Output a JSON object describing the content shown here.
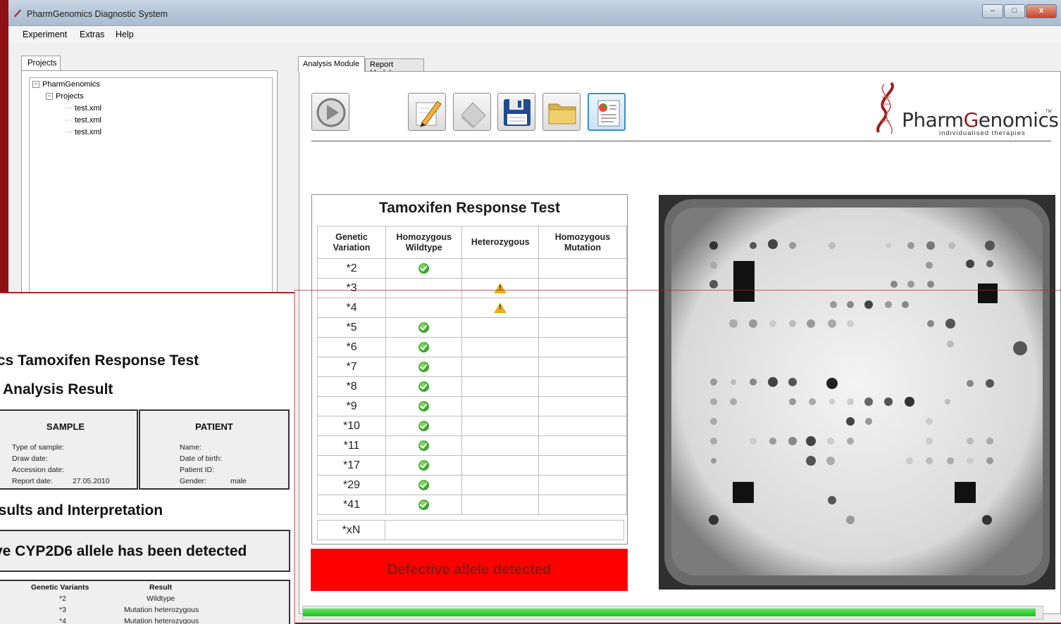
{
  "window": {
    "title": "PharmGenomics Diagnostic System"
  },
  "menu": [
    "Experiment",
    "Extras",
    "Help"
  ],
  "left_panel": {
    "tab_label": "Projects",
    "tree": {
      "root": "PharmGenomics",
      "folder": "Projects",
      "files": [
        "test.xml",
        "test.xml",
        "test.xml"
      ]
    }
  },
  "tabs": {
    "analysis": "Analysis Module",
    "report": "Report Module"
  },
  "toolbar": {
    "icons": [
      "play-icon",
      "edit-pencil-icon",
      "eraser-icon",
      "save-disk-icon",
      "open-folder-icon",
      "report-document-icon"
    ]
  },
  "logo": {
    "pre": "Pharm",
    "g": "G",
    "post": "enomics",
    "tm": "TM",
    "tagline": "individualised therapies"
  },
  "test": {
    "title": "Tamoxifen Response Test",
    "headers": {
      "genetic_variation": "Genetic Variation",
      "hom_wildtype": "Homozygous Wildtype",
      "heterozygous": "Heterozygous",
      "hom_mutation": "Homozygous Mutation"
    },
    "rows": [
      {
        "variant": "*2",
        "status": "wildtype"
      },
      {
        "variant": "*3",
        "status": "heterozygous"
      },
      {
        "variant": "*4",
        "status": "heterozygous"
      },
      {
        "variant": "*5",
        "status": "wildtype"
      },
      {
        "variant": "*6",
        "status": "wildtype"
      },
      {
        "variant": "*7",
        "status": "wildtype"
      },
      {
        "variant": "*8",
        "status": "wildtype"
      },
      {
        "variant": "*9",
        "status": "wildtype"
      },
      {
        "variant": "*10",
        "status": "wildtype"
      },
      {
        "variant": "*11",
        "status": "wildtype"
      },
      {
        "variant": "*17",
        "status": "wildtype"
      },
      {
        "variant": "*29",
        "status": "wildtype"
      },
      {
        "variant": "*41",
        "status": "wildtype"
      }
    ],
    "xn_label": "*xN",
    "result_banner": "Defective allele detected"
  },
  "progress": {
    "fraction": 0.99
  },
  "colors": {
    "banner_bg": "#ff0000",
    "banner_text": "#8b1a10",
    "progress": "#19c419",
    "window_frame": "#8f1014"
  },
  "report": {
    "title_line": "ics Tamoxifen Response Test",
    "subtitle": "Analysis Result",
    "sample": {
      "heading": "SAMPLE",
      "fields": [
        {
          "label": "Type of sample:",
          "value": ""
        },
        {
          "label": "Draw date:",
          "value": ""
        },
        {
          "label": "Accession date:",
          "value": ""
        },
        {
          "label": "Report date:",
          "value": "27.05.2010"
        }
      ]
    },
    "patient": {
      "heading": "PATIENT",
      "fields": [
        {
          "label": "Name:",
          "value": ""
        },
        {
          "label": "Date of birth:",
          "value": ""
        },
        {
          "label": "Patient ID:",
          "value": ""
        },
        {
          "label": "Gender:",
          "value": "male"
        }
      ]
    },
    "results_heading": "esults and Interpretation",
    "detection": "ve CYP2D6 allele has been detected",
    "variants_header": [
      "Genetic Variants",
      "Result"
    ],
    "variants": [
      {
        "variant": "*2",
        "result": "Wildtype"
      },
      {
        "variant": "*3",
        "result": "Mutation heterozygous"
      },
      {
        "variant": "*4",
        "result": "Mutation heterozygous"
      }
    ]
  }
}
